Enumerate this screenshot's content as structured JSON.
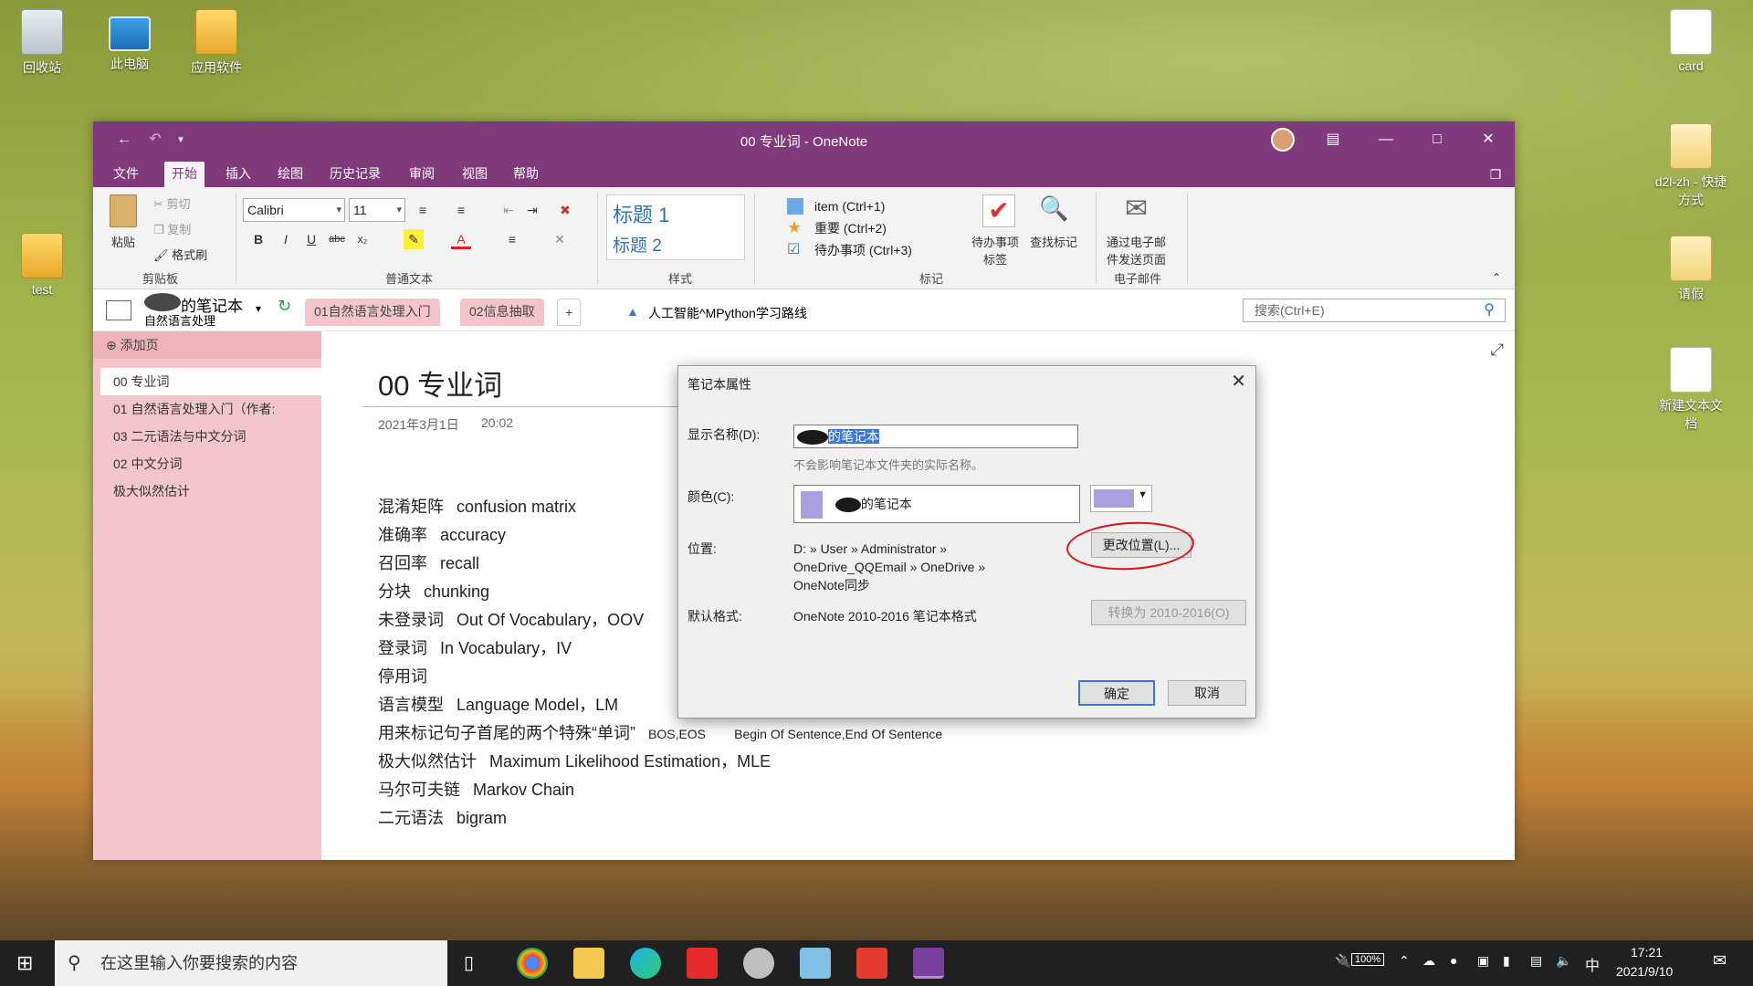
{
  "desktop": {
    "icons": [
      {
        "label": "回收站"
      },
      {
        "label": "此电脑"
      },
      {
        "label": "应用软件"
      },
      {
        "label": "test"
      },
      {
        "label": "card"
      },
      {
        "label": "d2l-zh - 快捷方式"
      },
      {
        "label": "请假"
      },
      {
        "label": "新建文本文档"
      }
    ]
  },
  "window": {
    "title": "00  专业词 - OneNote",
    "tabs": [
      "文件",
      "开始",
      "插入",
      "绘图",
      "历史记录",
      "审阅",
      "视图",
      "帮助"
    ],
    "active_tab": "开始"
  },
  "ribbon": {
    "clipboard": {
      "paste": "粘贴",
      "cut": "剪切",
      "copy": "复制",
      "format_painter": "格式刷",
      "group": "剪贴板"
    },
    "text": {
      "font": "Calibri",
      "size": "11",
      "bold": "B",
      "italic": "I",
      "underline": "U",
      "strike": "abc",
      "sub": "x₂",
      "group": "普通文本"
    },
    "styles": {
      "h1": "标题 1",
      "h2": "标题 2",
      "group": "样式"
    },
    "tags": {
      "item1": "item (Ctrl+1)",
      "item2": "重要 (Ctrl+2)",
      "item3": "待办事项 (Ctrl+3)",
      "todo_tag": "待办事项\n标签",
      "find_tags": "查找标记",
      "group": "标记"
    },
    "email": {
      "send": "通过电子邮\n件发送页面",
      "group": "电子邮件"
    }
  },
  "notebook_bar": {
    "notebook_name": "的笔记本",
    "section": "自然语言处理",
    "section_tabs": [
      "01自然语言处理入门",
      "02信息抽取",
      "+"
    ],
    "breadcrumb": "人工智能^MPython学习路线",
    "search_placeholder": "搜索(Ctrl+E)"
  },
  "pages": {
    "add_page": "添加页",
    "items": [
      "00  专业词",
      "01 自然语言处理入门（作者:",
      "03  二元语法与中文分词",
      "02 中文分词",
      "极大似然估计"
    ]
  },
  "page": {
    "title": "00  专业词",
    "date": "2021年3月1日",
    "time": "20:02",
    "lines": [
      {
        "zh": "混淆矩阵",
        "en": "confusion matrix"
      },
      {
        "zh": "准确率",
        "en": "accuracy"
      },
      {
        "zh": "召回率",
        "en": "recall"
      },
      {
        "zh": "分块",
        "en": "chunking"
      },
      {
        "zh": "未登录词",
        "en": "Out Of Vocabulary，OOV"
      },
      {
        "zh": "登录词",
        "en": "In Vocabulary，IV"
      },
      {
        "zh": "停用词",
        "en": ""
      },
      {
        "zh": "语言模型",
        "en": "Language Model，LM"
      },
      {
        "zh": "用来标记句子首尾的两个特殊“单词”",
        "en": "BOS,EOS        Begin Of Sentence,End Of Sentence"
      },
      {
        "zh": "极大似然估计",
        "en": "Maximum Likelihood Estimation，MLE"
      },
      {
        "zh": "马尔可夫链",
        "en": "Markov Chain"
      },
      {
        "zh": "二元语法",
        "en": "bigram"
      }
    ]
  },
  "dialog": {
    "title": "笔记本属性",
    "display_name_label": "显示名称(D):",
    "display_name_value": "的笔记本",
    "display_name_hint": "不会影响笔记本文件夹的实际名称。",
    "color_label": "颜色(C):",
    "color_value": "的笔记本",
    "color_swatch": "#a9a0e0",
    "location_label": "位置:",
    "location_value": "D: » User » Administrator » OneDrive_QQEmail » OneDrive » OneNote同步",
    "change_location": "更改位置(L)...",
    "format_label": "默认格式:",
    "format_value": "OneNote 2010-2016 笔记本格式",
    "convert": "转换为 2010-2016(O)",
    "ok": "确定",
    "cancel": "取消"
  },
  "taskbar": {
    "search_placeholder": "在这里输入你要搜索的内容",
    "battery": "100%",
    "ime": "中",
    "time": "17:21",
    "date": "2021/9/10"
  },
  "colors": {
    "onenote_purple": "#80397b",
    "section_pink": "#f4c6cb",
    "annotation_red": "#e01010"
  }
}
